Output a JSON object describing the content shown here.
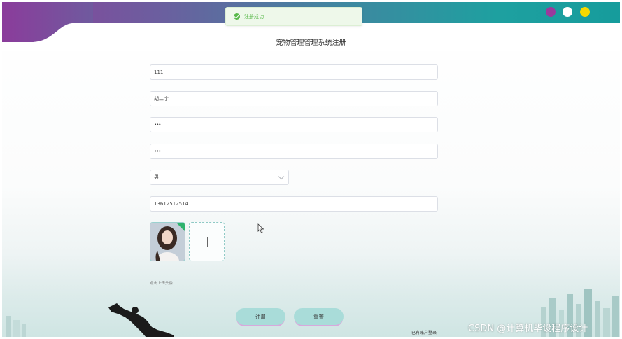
{
  "toast": {
    "message": "注册成功",
    "icon": "check-circle-icon",
    "color": "#58b94a"
  },
  "header": {
    "colors": [
      "#9a3a9c",
      "#ffffff",
      "#f5d800"
    ]
  },
  "form": {
    "title": "宠物管理管理系统注册",
    "account": "111",
    "name": "胡二宇",
    "password": "•••",
    "confirm_password": "•••",
    "gender": "男",
    "phone": "13612512514",
    "upload_hint": "点击上传头像"
  },
  "buttons": {
    "register": "注册",
    "reset": "重置"
  },
  "links": {
    "login": "已有账户登录"
  },
  "watermark": "CSDN @计算机毕设程序设计"
}
